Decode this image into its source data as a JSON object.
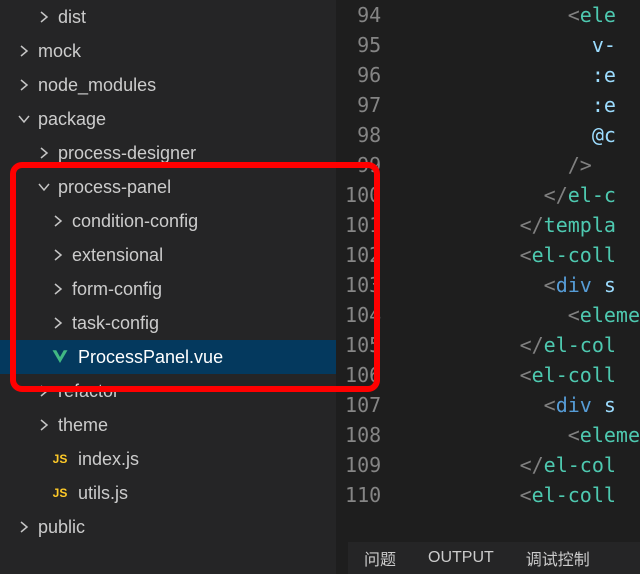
{
  "tree": {
    "dist": "dist",
    "mock": "mock",
    "node_modules": "node_modules",
    "package": "package",
    "process_designer": "process-designer",
    "process_panel": "process-panel",
    "condition_config": "condition-config",
    "extensional": "extensional",
    "form_config": "form-config",
    "task_config": "task-config",
    "process_panel_vue": "ProcessPanel.vue",
    "refactor": "refactor",
    "theme": "theme",
    "index_js": "index.js",
    "utils_js": "utils.js",
    "public": "public"
  },
  "code": {
    "lines": [
      "94",
      "95",
      "96",
      "97",
      "98",
      "99",
      "100",
      "101",
      "102",
      "103",
      "104",
      "105",
      "106",
      "107",
      "108",
      "109",
      "110"
    ],
    "l94": {
      "pre": "              <",
      "t": "ele"
    },
    "l95": {
      "pre": "                ",
      "a": "v-"
    },
    "l96": {
      "pre": "                ",
      "a": ":e"
    },
    "l97": {
      "pre": "                ",
      "a": ":e"
    },
    "l98": {
      "pre": "                ",
      "a": "@c"
    },
    "l99": {
      "pre": "              />",
      "t": ""
    },
    "l100": {
      "pre": "            </",
      "t": "el-c"
    },
    "l101": {
      "pre": "          </",
      "t": "templa"
    },
    "l102": {
      "pre": "          <",
      "t": "el-coll"
    },
    "l103": {
      "pre": "            <",
      "t2": "div",
      "sp": " ",
      "a": "s"
    },
    "l104": {
      "pre": "              <",
      "t": "eleme"
    },
    "l105": {
      "pre": "          </",
      "t": "el-col"
    },
    "l106": {
      "pre": "          <",
      "t": "el-coll"
    },
    "l107": {
      "pre": "            <",
      "t2": "div",
      "sp": " ",
      "a": "s"
    },
    "l108": {
      "pre": "              <",
      "t": "eleme"
    },
    "l109": {
      "pre": "          </",
      "t": "el-col"
    },
    "l110": {
      "pre": "          <",
      "t": "el-coll"
    }
  },
  "status": {
    "problems": "问题",
    "output": "OUTPUT",
    "debug": "调试控制"
  }
}
